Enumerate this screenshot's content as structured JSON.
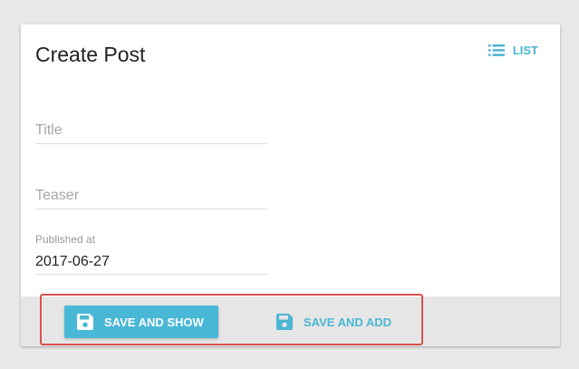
{
  "header": {
    "title": "Create Post",
    "list_label": "LIST"
  },
  "form": {
    "title_placeholder": "Title",
    "teaser_placeholder": "Teaser",
    "published_label": "Published at",
    "published_value": "2017-06-27"
  },
  "toolbar": {
    "save_show_label": "SAVE AND SHOW",
    "save_add_label": "SAVE AND ADD"
  },
  "colors": {
    "accent": "#48b8d6",
    "highlight": "#d9534f",
    "background": "#e8e8e8",
    "toolbar_bg": "#e6e6e6"
  },
  "icons": [
    "list-icon",
    "save-icon"
  ]
}
